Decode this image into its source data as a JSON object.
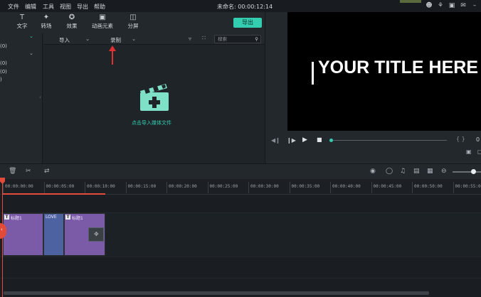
{
  "menu": {
    "items": [
      "文件",
      "编辑",
      "工具",
      "视图",
      "导出",
      "帮助"
    ],
    "title": "未命名: 00:00:12:14"
  },
  "toolbar": {
    "tools": [
      {
        "label": "文字",
        "icon": "text-icon"
      },
      {
        "label": "转场",
        "icon": "transition-icon"
      },
      {
        "label": "效果",
        "icon": "effects-icon"
      },
      {
        "label": "动画元素",
        "icon": "elements-icon"
      },
      {
        "label": "分屏",
        "icon": "split-screen-icon"
      }
    ],
    "export_label": "导出"
  },
  "left_panel": {
    "items": [
      "(0)",
      "(0)",
      "(0)",
      ")",
      ")"
    ]
  },
  "media": {
    "import_label": "导入",
    "record_label": "录制",
    "search_placeholder": "搜索",
    "import_hint": "点击导入媒体文件"
  },
  "preview": {
    "title_text": "YOUR TITLE HERE",
    "brackets": "{ }",
    "partial_time": "0"
  },
  "ruler": {
    "ticks": [
      "00:00:00:00",
      "00:00:05:00",
      "00:00:10:00",
      "00:00:15:00",
      "00:00:20:00",
      "00:00:25:00",
      "00:00:30:00",
      "00:00:35:00",
      "00:00:40:00",
      "00:00:45:00",
      "00:00:50:00",
      "00:00:55:00"
    ]
  },
  "clips": [
    {
      "label": "标题1",
      "color": "#7b5aa8",
      "has_t": true
    },
    {
      "label": "LOVE",
      "color": "#4d62a0",
      "has_t": false
    },
    {
      "label": "标题1",
      "color": "#7b5aa8",
      "has_t": true
    }
  ],
  "colors": {
    "accent": "#33cdb0",
    "playhead": "#e24a3a"
  }
}
